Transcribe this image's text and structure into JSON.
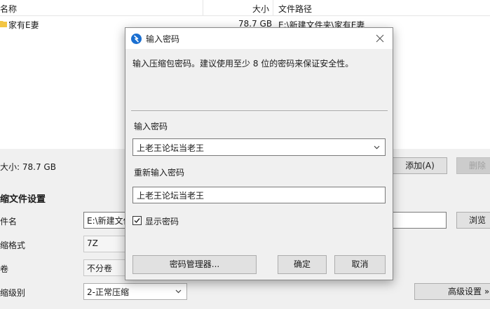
{
  "file_list": {
    "columns": {
      "name": "名称",
      "size": "大小",
      "path": "文件路径"
    },
    "rows": [
      {
        "name": "家有E妻",
        "size": "78.7 GB",
        "path": "E:\\新建文件夹\\家有E妻"
      }
    ]
  },
  "summary": "大小: 78.7 GB",
  "add_button": "添加(A)",
  "delete_button": "删除",
  "settings": {
    "title": "缩文件设置",
    "filename_label": "件名",
    "filename_value": "E:\\新建文件",
    "browse_button": "浏览",
    "format_label": "缩格式",
    "format_value": "7Z",
    "volume_label": "卷",
    "volume_value": "不分卷",
    "level_label": "缩级别",
    "level_value": "2-正常压缩",
    "advanced_button": "高级设置 »"
  },
  "dialog": {
    "title": "输入密码",
    "info": "输入压缩包密码。建议使用至少 8 位的密码来保证安全性。",
    "password_label": "输入密码",
    "password_value": "上老王论坛当老王",
    "confirm_label": "重新输入密码",
    "confirm_value": "上老王论坛当老王",
    "show_password_label": "显示密码",
    "show_password_checked": true,
    "manager_button": "密码管理器...",
    "ok_button": "确定",
    "cancel_button": "取消"
  },
  "colors": {
    "app_icon": "#1a6fd1",
    "folder": "#f3c543"
  }
}
